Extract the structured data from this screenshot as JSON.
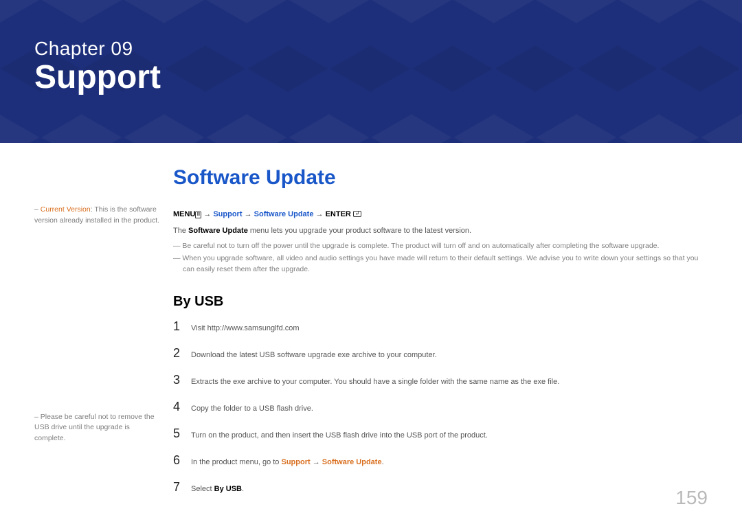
{
  "banner": {
    "chapter_label": "Chapter  09",
    "chapter_title": "Support"
  },
  "sidebar": {
    "note1_prefix": "– ",
    "note1_bold": "Current Version",
    "note1_rest": ": This is the software version already installed in the product.",
    "note2": "Please be careful not to remove the USB drive until the upgrade is complete."
  },
  "main": {
    "section_heading": "Software Update",
    "menu_path": {
      "menu_label": "MENU",
      "arrow": " → ",
      "seg1": "Support",
      "seg2": "Software Update",
      "enter_label": "ENTER"
    },
    "intro": {
      "p1_pre": "The ",
      "p1_bold": "Software Update",
      "p1_post": " menu lets you upgrade your product software to the latest version."
    },
    "notes": {
      "n1": "Be careful not to turn off the power until the upgrade is complete. The product will turn off and on automatically after completing the software upgrade.",
      "n2": "When you upgrade software, all video and audio settings you have made will return to their default settings. We advise you to write down your settings so that you can easily reset them after the upgrade."
    },
    "sub_heading": "By USB",
    "steps": [
      {
        "n": "1",
        "text": "Visit http://www.samsunglfd.com"
      },
      {
        "n": "2",
        "text": "Download the latest USB software upgrade exe archive to your computer."
      },
      {
        "n": "3",
        "text": "Extracts the exe archive to your computer. You should have a single folder with the same name as the exe file."
      },
      {
        "n": "4",
        "text": "Copy the folder to a USB flash drive."
      },
      {
        "n": "5",
        "text": "Turn on the product, and then insert the USB flash drive into the USB port of the product."
      },
      {
        "n": "6",
        "pre": "In the product menu, go to ",
        "orange1": "Support",
        "mid": " → ",
        "orange2": "Software Update",
        "post": "."
      },
      {
        "n": "7",
        "pre": "Select ",
        "bold": "By USB",
        "post": "."
      }
    ]
  },
  "page_number": "159"
}
